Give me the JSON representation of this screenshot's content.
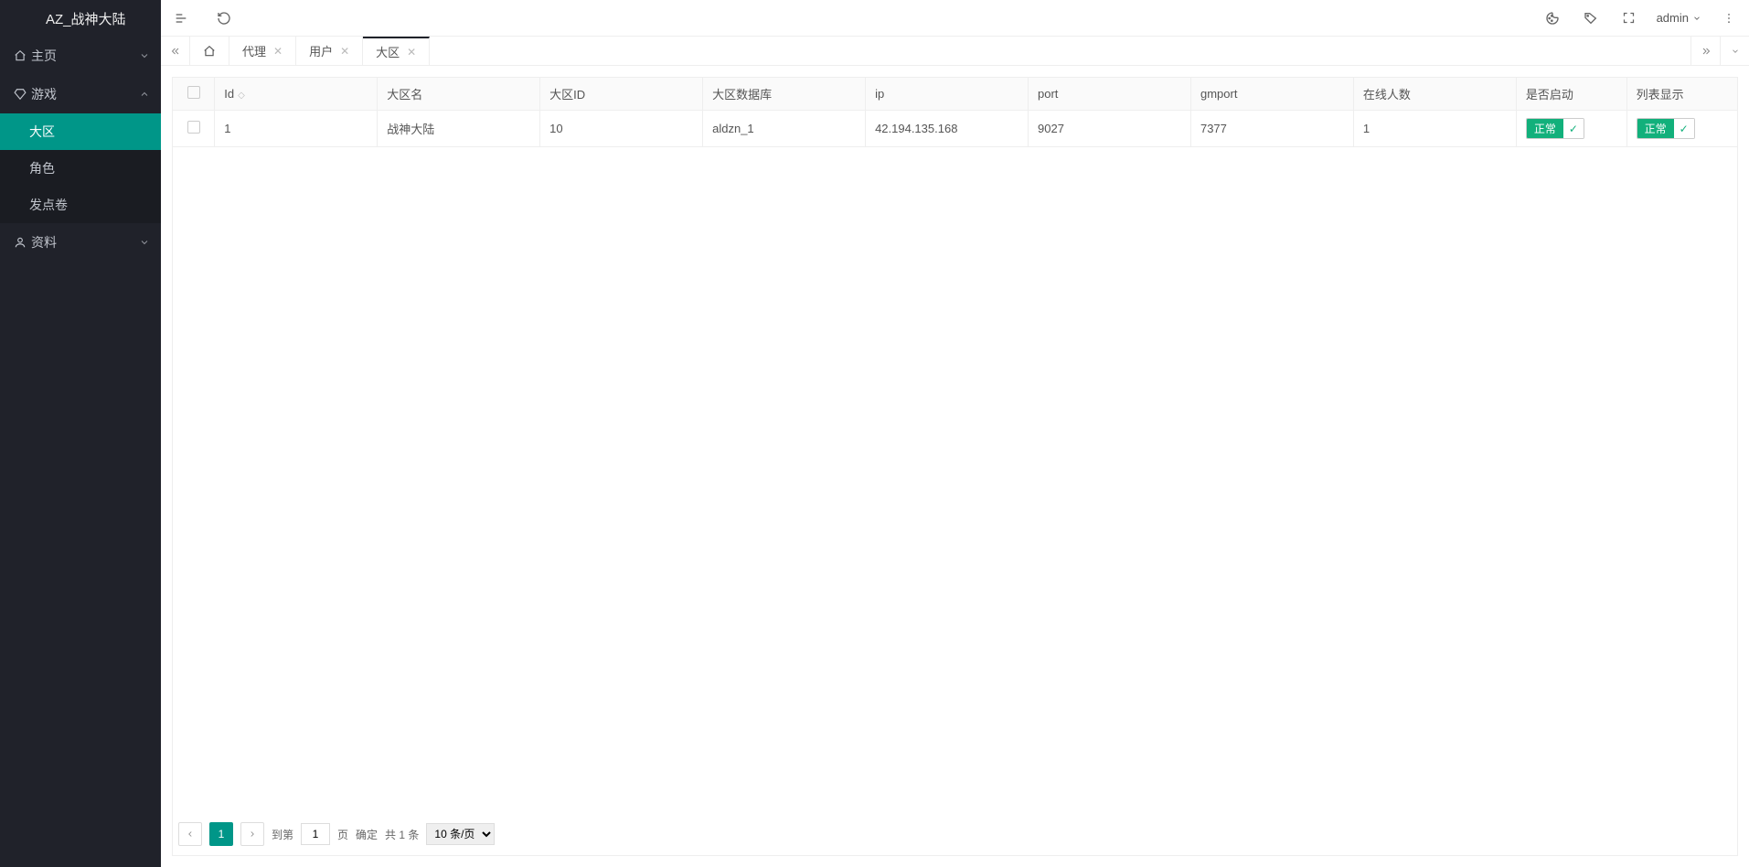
{
  "brand": "AZ_战神大陆",
  "user": {
    "name": "admin"
  },
  "nav": [
    {
      "icon": "home",
      "label": "主页",
      "expand": "down",
      "sub": []
    },
    {
      "icon": "diamond",
      "label": "游戏",
      "expand": "up",
      "sub": [
        {
          "label": "大区",
          "active": true
        },
        {
          "label": "角色",
          "active": false
        },
        {
          "label": "发点卷",
          "active": false
        }
      ]
    },
    {
      "icon": "user",
      "label": "资料",
      "expand": "down",
      "sub": []
    }
  ],
  "tabs": [
    {
      "label": "代理",
      "active": false
    },
    {
      "label": "用户",
      "active": false
    },
    {
      "label": "大区",
      "active": true
    }
  ],
  "table": {
    "columns": [
      "Id",
      "大区名",
      "大区ID",
      "大区数据库",
      "ip",
      "port",
      "gmport",
      "在线人数",
      "是否启动",
      "列表显示"
    ],
    "rows": [
      {
        "id": "1",
        "name": "战神大陆",
        "zoneId": "10",
        "db": "aldzn_1",
        "ip": "42.194.135.168",
        "port": "9027",
        "gmport": "7377",
        "online": "1",
        "status": "正常",
        "listShow": "正常"
      }
    ]
  },
  "pager": {
    "current": "1",
    "goto_prefix": "到第",
    "goto_value": "1",
    "goto_suffix": "页",
    "confirm": "确定",
    "total": "共 1 条",
    "perpage": "10 条/页"
  }
}
